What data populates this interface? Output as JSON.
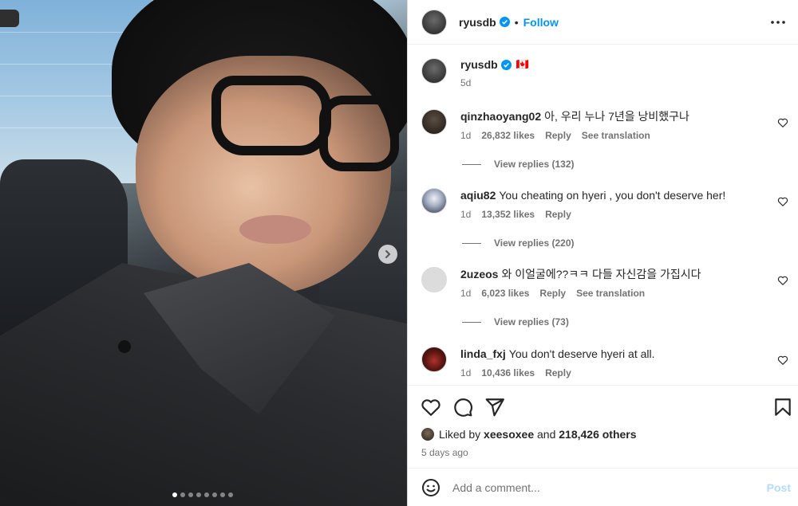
{
  "post": {
    "username": "ryusdb",
    "follow_label": "Follow",
    "separator": "•",
    "caption_time": "5d",
    "flag": "🇨🇦"
  },
  "carousel": {
    "slide_count": 8,
    "active_index": 0
  },
  "comments": [
    {
      "username": "qinzhaoyang02",
      "text": "아, 우리 누나 7년을 낭비했구나",
      "time": "1d",
      "likes": "26,832 likes",
      "reply_label": "Reply",
      "translate_label": "See translation",
      "view_replies": "View replies (132)"
    },
    {
      "username": "aqiu82",
      "text": "You cheating on hyeri , you don't deserve her!",
      "time": "1d",
      "likes": "13,352 likes",
      "reply_label": "Reply",
      "view_replies": "View replies (220)"
    },
    {
      "username": "2uzeos",
      "text": "와 이얼굴에??ㅋㅋ 다들 자신감을 가집시다",
      "time": "1d",
      "likes": "6,023 likes",
      "reply_label": "Reply",
      "translate_label": "See translation",
      "view_replies": "View replies (73)"
    },
    {
      "username": "linda_fxj",
      "text": "You don't deserve hyeri at all.",
      "time": "1d",
      "likes": "10,436 likes",
      "reply_label": "Reply"
    }
  ],
  "likes": {
    "prefix": "Liked by ",
    "user": "xeesoxee",
    "joiner": " and ",
    "others": "218,426 others",
    "ago": "5 days ago"
  },
  "compose": {
    "placeholder": "Add a comment...",
    "post_label": "Post"
  },
  "colors": {
    "accent": "#0095f6",
    "verified": "#0095f6",
    "muted": "#737373"
  },
  "icons": [
    "verified-badge-icon",
    "more-options-icon",
    "chevron-right-icon",
    "heart-icon",
    "comment-icon",
    "share-icon",
    "bookmark-icon",
    "emoji-icon"
  ]
}
